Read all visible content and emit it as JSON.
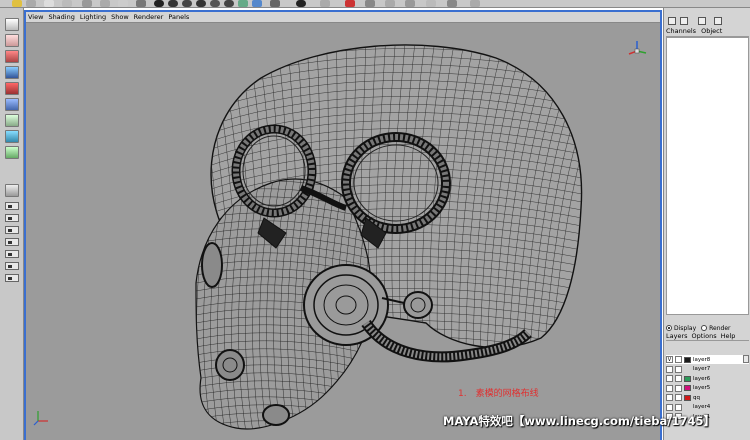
{
  "viewport_menu": [
    "View",
    "Shading",
    "Lighting",
    "Show",
    "Renderer",
    "Panels"
  ],
  "channel_box": {
    "tabs": [
      "Channels",
      "Object"
    ]
  },
  "layer_editor": {
    "radio_options": [
      {
        "label": "Display",
        "selected": true
      },
      {
        "label": "Render",
        "selected": false
      }
    ],
    "menu": [
      "Layers",
      "Options",
      "Help"
    ],
    "layers": [
      {
        "name": "layer8",
        "color": "#1a1a1a",
        "selected": true
      },
      {
        "name": "layer7",
        "color": "",
        "selected": false
      },
      {
        "name": "layer6",
        "color": "#2c9a5a",
        "selected": false
      },
      {
        "name": "layer5",
        "color": "#d0107a",
        "selected": false
      },
      {
        "name": "qq",
        "color": "#d01818",
        "selected": false
      },
      {
        "name": "layer4",
        "color": "",
        "selected": false
      },
      {
        "name": "layer1",
        "color": "",
        "selected": false
      }
    ]
  },
  "annotation": "1.　素模的网格布线",
  "watermark": "MAYA特效吧【www.linecg.com/tieba/1745】",
  "colors": {
    "viewport_bg": "#9b9b9b",
    "active_panel_border": "#3a6fd0",
    "ui_gray": "#d4d4d4",
    "annotation_red": "#e03030"
  }
}
